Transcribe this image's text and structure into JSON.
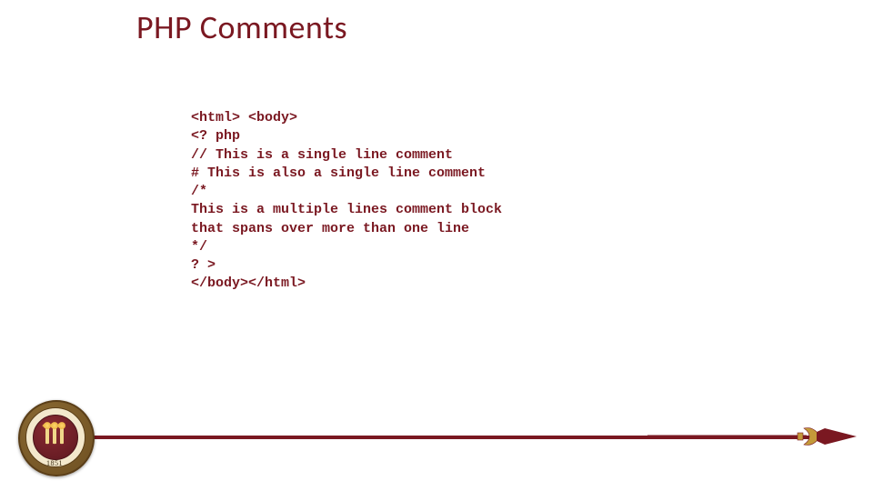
{
  "title": "PHP Comments",
  "code": {
    "l1": "<html> <body>",
    "l2": "<? php",
    "l3": "// This is a single line comment",
    "l4": "# This is also a single line comment",
    "l5": "/*",
    "l6": "This is a multiple lines comment block",
    "l7": "that spans over more than one line",
    "l8": "*/",
    "l9": "? >",
    "l10": "</body></html>"
  },
  "seal": {
    "year": "1851"
  }
}
